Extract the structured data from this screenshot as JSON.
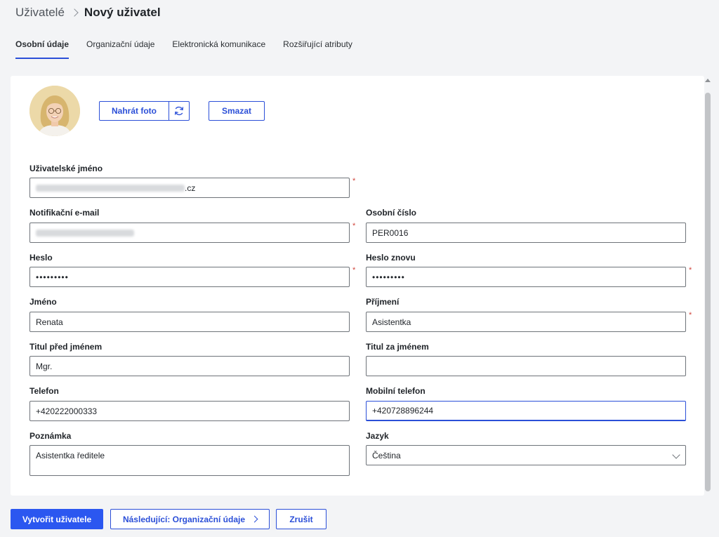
{
  "breadcrumb": {
    "parent": "Uživatelé",
    "current": "Nový uživatel"
  },
  "tabs": [
    {
      "label": "Osobní údaje",
      "active": true
    },
    {
      "label": "Organizační údaje",
      "active": false
    },
    {
      "label": "Elektronická komunikace",
      "active": false
    },
    {
      "label": "Rozšiřující atributy",
      "active": false
    }
  ],
  "photo": {
    "upload_label": "Nahrát foto",
    "delete_label": "Smazat",
    "refresh_icon": "refresh-icon",
    "avatar_icon": "user-photo"
  },
  "form": {
    "username": {
      "label": "Uživatelské jméno",
      "value_suffix": ".cz",
      "required": true
    },
    "notify_email": {
      "label": "Notifikační e-mail",
      "required": true
    },
    "personal_number": {
      "label": "Osobní číslo",
      "value": "PER0016"
    },
    "password": {
      "label": "Heslo",
      "value": "•••••••••",
      "required": true
    },
    "password_again": {
      "label": "Heslo znovu",
      "value": "•••••••••",
      "required": true
    },
    "first_name": {
      "label": "Jméno",
      "value": "Renata"
    },
    "last_name": {
      "label": "Příjmení",
      "value": "Asistentka",
      "required": true
    },
    "title_before": {
      "label": "Titul před jménem",
      "value": "Mgr."
    },
    "title_after": {
      "label": "Titul za jménem",
      "value": ""
    },
    "phone": {
      "label": "Telefon",
      "value": "+420222000333"
    },
    "mobile": {
      "label": "Mobilní telefon",
      "value": "+420728896244"
    },
    "note": {
      "label": "Poznámka",
      "value": "Asistentka ředitele"
    },
    "language": {
      "label": "Jazyk",
      "value": "Čeština"
    },
    "required_mark": "*"
  },
  "actions": {
    "create": "Vytvořit uživatele",
    "next": "Následující: Organizační údaje",
    "cancel": "Zrušit"
  },
  "colors": {
    "accent": "#2b4fd8",
    "primary_button": "#2b57f0",
    "required": "#d0463e",
    "background": "#f3f4f6"
  }
}
